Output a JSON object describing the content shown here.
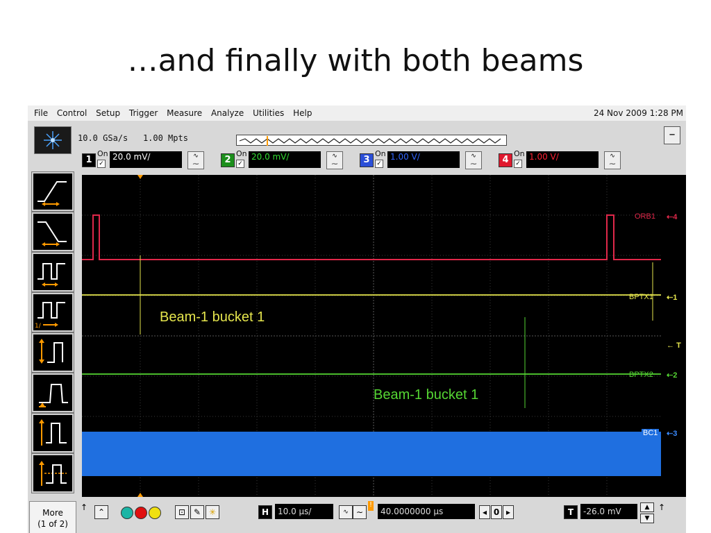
{
  "slide_title": "…and finally with both beams",
  "menu": {
    "items": [
      "File",
      "Control",
      "Setup",
      "Trigger",
      "Measure",
      "Analyze",
      "Utilities",
      "Help"
    ],
    "datetime": "24 Nov 2009  1:28 PM"
  },
  "acquisition": {
    "sample_rate": "10.0 GSa/s",
    "memory_depth": "1.00 Mpts"
  },
  "channels": [
    {
      "num": "1",
      "on_label": "On",
      "scale": "20.0 mV/",
      "color": "#ff3355"
    },
    {
      "num": "2",
      "on_label": "On",
      "scale": "20.0 mV/",
      "color": "#33dd33"
    },
    {
      "num": "3",
      "on_label": "On",
      "scale": "1.00 V/",
      "color": "#3366ff"
    },
    {
      "num": "4",
      "on_label": "On",
      "scale": "1.00 V/",
      "color": "#ff2233"
    }
  ],
  "traces": {
    "orb1": {
      "label": "ORB1",
      "marker": "4",
      "color": "#e0284a"
    },
    "bptx1": {
      "label": "BPTX1",
      "marker": "1",
      "color": "#e6e64d"
    },
    "bptx2": {
      "label": "BPTX2",
      "marker": "2",
      "color": "#55d633"
    },
    "bc1": {
      "label": "BC1",
      "marker": "3",
      "color": "#1f6fe0"
    }
  },
  "annotations": {
    "beam_yellow": "Beam-1 bucket 1",
    "beam_green": "Beam-1 bucket 1"
  },
  "trigger_marker": "T",
  "sidebar": {
    "more_label": "More",
    "more_sub": "(1 of 2)"
  },
  "bottom_bar": {
    "h_label": "H",
    "timebase": "10.0 µs/",
    "delay": "40.0000000 µs",
    "nav_value": "0",
    "t_label": "T",
    "trigger_level": "-26.0 mV"
  }
}
